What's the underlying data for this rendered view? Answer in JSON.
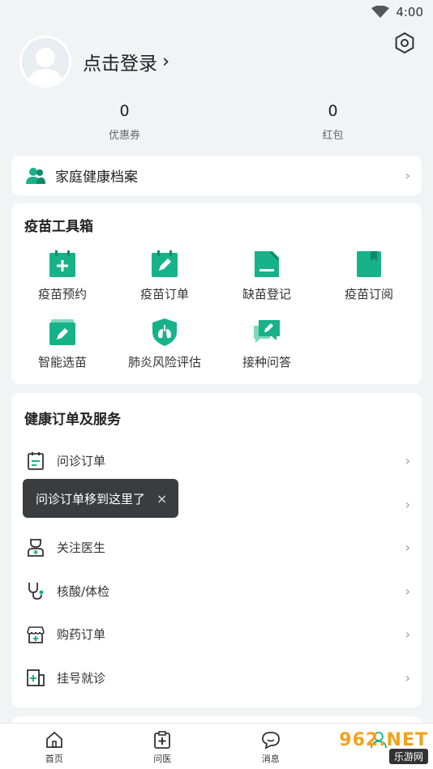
{
  "status": {
    "time": "4:00"
  },
  "profile": {
    "login_text": "点击登录",
    "chevron": "›"
  },
  "stats": [
    {
      "value": "0",
      "label": "优惠券"
    },
    {
      "value": "0",
      "label": "红包"
    }
  ],
  "family": {
    "label": "家庭健康档案",
    "icon": "family-person-icon"
  },
  "vaccine_toolbox": {
    "title": "疫苗工具箱",
    "items": [
      {
        "label": "疫苗预约",
        "icon": "calendar-plus-icon"
      },
      {
        "label": "疫苗订单",
        "icon": "calendar-edit-icon"
      },
      {
        "label": "缺苗登记",
        "icon": "document-edit-icon"
      },
      {
        "label": "疫苗订阅",
        "icon": "bookmark-icon"
      },
      {
        "label": "智能选苗",
        "icon": "smart-select-icon"
      },
      {
        "label": "肺炎风险评估",
        "icon": "lungs-shield-icon"
      },
      {
        "label": "接种问答",
        "icon": "chat-edit-icon"
      }
    ]
  },
  "health_services": {
    "title": "健康订单及服务",
    "items": [
      {
        "label": "问诊订单",
        "icon": "clipboard-list-icon"
      },
      {
        "label": "",
        "icon": "document-icon"
      },
      {
        "label": "关注医生",
        "icon": "doctor-icon"
      },
      {
        "label": "核酸/体检",
        "icon": "stethoscope-icon"
      },
      {
        "label": "购药订单",
        "icon": "pharmacy-store-icon"
      },
      {
        "label": "挂号就诊",
        "icon": "registration-icon"
      }
    ]
  },
  "tooltip": {
    "text": "问诊订单移到这里了",
    "close": "×"
  },
  "tabbar": [
    {
      "label": "首页",
      "icon": "home-icon"
    },
    {
      "label": "问医",
      "icon": "medical-kit-icon"
    },
    {
      "label": "消息",
      "icon": "message-icon"
    },
    {
      "label": "",
      "icon": "profile-icon"
    }
  ],
  "watermark": {
    "top": "962.NET",
    "bottom": "乐游网"
  },
  "colors": {
    "accent": "#18b28a",
    "background": "#f2f3f5"
  }
}
